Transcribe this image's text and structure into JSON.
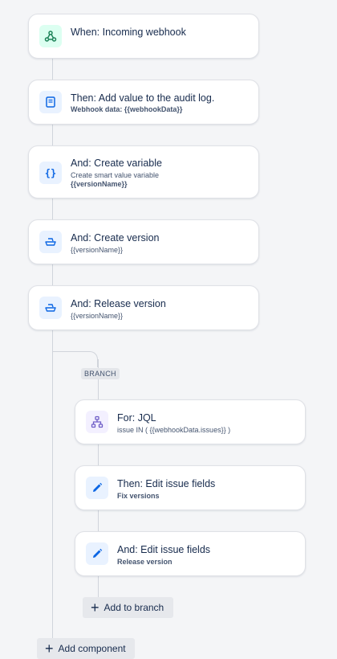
{
  "steps": [
    {
      "title": "When: Incoming webhook",
      "icon": "webhook-icon"
    },
    {
      "title": "Then: Add value to the audit log.",
      "sub": "Webhook data: {{webhookData}}",
      "icon": "audit-log-icon"
    },
    {
      "title": "And: Create variable",
      "sub1": "Create smart value variable",
      "sub2": "{{versionName}}",
      "icon": "variable-icon"
    },
    {
      "title": "And: Create version",
      "sub": "{{versionName}}",
      "icon": "ship-icon"
    },
    {
      "title": "And: Release version",
      "sub": "{{versionName}}",
      "icon": "ship-icon"
    }
  ],
  "branch": {
    "label": "BRANCH",
    "steps": [
      {
        "title": "For: JQL",
        "sub": "issue IN ( {{webhookData.issues}} )",
        "icon": "hierarchy-icon"
      },
      {
        "title": "Then: Edit issue fields",
        "sub": "Fix versions",
        "icon": "edit-icon"
      },
      {
        "title": "And: Edit issue fields",
        "sub": "Release version",
        "icon": "edit-icon"
      }
    ],
    "add_label": "Add to branch"
  },
  "add_component_label": "Add component",
  "colors": {
    "webhook_bg": "#dcfff1",
    "icon_bg": "#e9f2ff",
    "icon_blue": "#0c66e4",
    "purple_bg": "#f3f0ff",
    "purple": "#6e5dc6"
  }
}
